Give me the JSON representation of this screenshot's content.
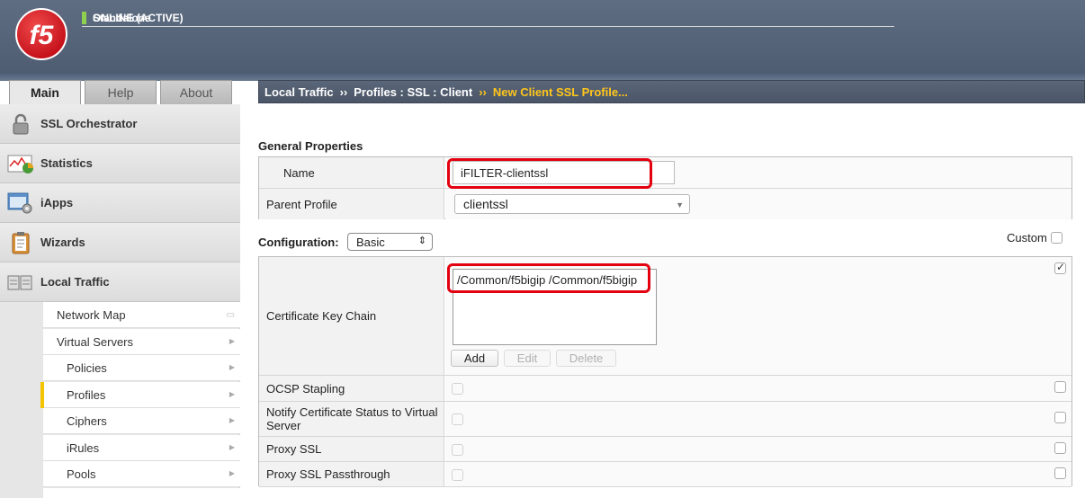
{
  "header": {
    "status_lines": [
      "ONLINE (ACTIVE)",
      "Standalone"
    ],
    "logo_text": "f5"
  },
  "tabs": [
    {
      "label": "Main",
      "active": true
    },
    {
      "label": "Help",
      "active": false
    },
    {
      "label": "About",
      "active": false
    }
  ],
  "sidebar": {
    "sections": [
      {
        "label": "SSL Orchestrator",
        "icon": "lock-icon"
      },
      {
        "label": "Statistics",
        "icon": "chart-icon"
      },
      {
        "label": "iApps",
        "icon": "app-gear-icon"
      },
      {
        "label": "Wizards",
        "icon": "clipboard-icon"
      },
      {
        "label": "Local Traffic",
        "icon": "servers-icon"
      }
    ],
    "sub_items": [
      {
        "label": "Network Map",
        "indent": false,
        "marker": "external"
      },
      {
        "label": "Virtual Servers",
        "indent": false,
        "marker": "arrow"
      },
      {
        "label": "Policies",
        "indent": true,
        "marker": "arrow"
      },
      {
        "label": "Profiles",
        "indent": true,
        "marker": "arrow",
        "active": true
      },
      {
        "label": "Ciphers",
        "indent": true,
        "marker": "arrow"
      },
      {
        "label": "iRules",
        "indent": true,
        "marker": "arrow"
      },
      {
        "label": "Pools",
        "indent": true,
        "marker": "arrow"
      }
    ]
  },
  "breadcrumb": {
    "parts": [
      "Local Traffic",
      "Profiles : SSL : Client"
    ],
    "current": "New Client SSL Profile...",
    "separator": "››"
  },
  "general": {
    "title": "General Properties",
    "name_label": "Name",
    "name_value": "iFILTER-clientssl",
    "parent_label": "Parent Profile",
    "parent_value": "clientssl"
  },
  "configuration": {
    "label": "Configuration:",
    "mode": "Basic",
    "custom_label": "Custom"
  },
  "cert_key_chain": {
    "label": "Certificate Key Chain",
    "entries": [
      "/Common/f5bigip /Common/f5bigip"
    ],
    "buttons": {
      "add": "Add",
      "edit": "Edit",
      "delete": "Delete"
    }
  },
  "options": [
    {
      "label": "OCSP Stapling"
    },
    {
      "label": "Notify Certificate Status to Virtual Server"
    },
    {
      "label": "Proxy SSL"
    },
    {
      "label": "Proxy SSL Passthrough"
    }
  ],
  "colors": {
    "online": "#8fd14f",
    "highlight": "#e3000f",
    "breadcrumb_current": "#ffc61a",
    "active_marker": "#f5c400"
  }
}
